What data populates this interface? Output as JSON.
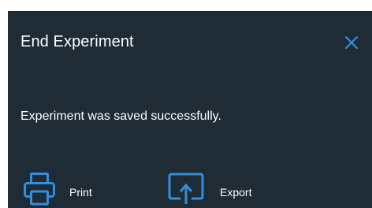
{
  "dialog": {
    "title": "End Experiment",
    "close_icon": "close-icon",
    "message": "Experiment was saved successfully.",
    "actions": [
      {
        "label": "Print",
        "icon": "printer-icon"
      },
      {
        "label": "Export",
        "icon": "export-icon"
      }
    ],
    "colors": {
      "background": "#1f2c36",
      "text": "#ffffff",
      "accent": "#2f8fe0"
    }
  }
}
